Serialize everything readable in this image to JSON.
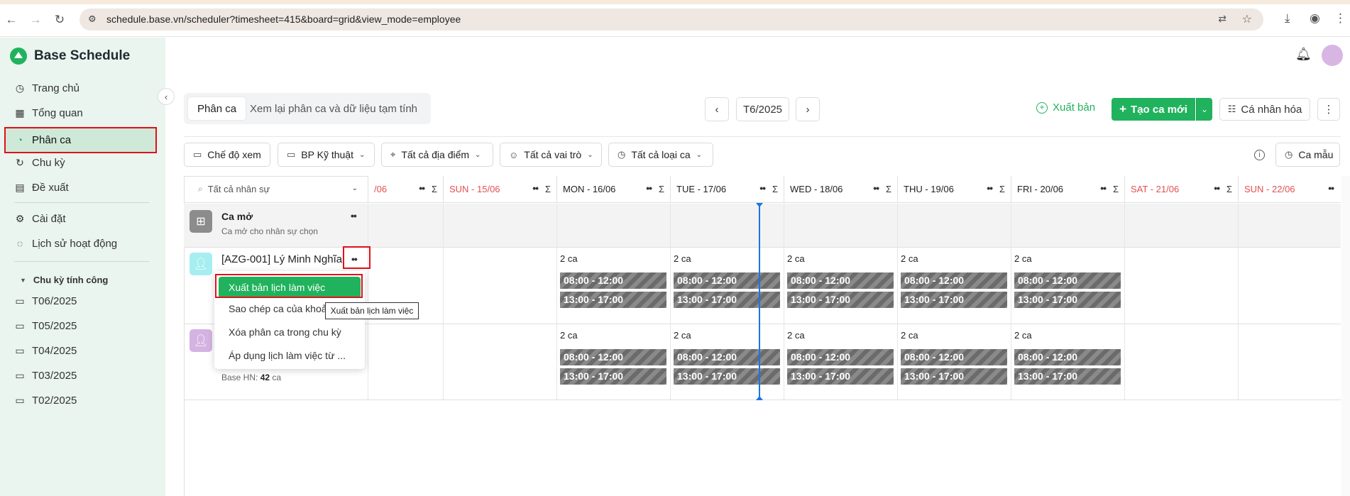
{
  "browser": {
    "url": "schedule.base.vn/scheduler?timesheet=415&board=grid&view_mode=employee"
  },
  "app": {
    "title": "Base Schedule"
  },
  "sidebar": {
    "items": [
      {
        "label": "Trang chủ",
        "icon": "clock-icon"
      },
      {
        "label": "Tổng quan",
        "icon": "grid-icon"
      },
      {
        "label": "Phân ca",
        "icon": "schedule-icon"
      },
      {
        "label": "Chu kỳ",
        "icon": "cycle-icon"
      },
      {
        "label": "Đề xuất",
        "icon": "document-icon"
      }
    ],
    "items2": [
      {
        "label": "Cài đặt",
        "icon": "gear-icon"
      },
      {
        "label": "Lịch sử hoạt động",
        "icon": "chat-icon"
      }
    ],
    "group_label": "Chu kỳ tính công",
    "periods": [
      "T06/2025",
      "T05/2025",
      "T04/2025",
      "T03/2025",
      "T02/2025"
    ]
  },
  "header": {
    "tab_active": "Phân ca",
    "tab_other": "Xem lại phân ca và dữ liệu tạm tính",
    "period": "T6/2025",
    "publish": "Xuất bản",
    "create": "Tạo ca mới",
    "personalize": "Cá nhân hóa",
    "more": "⋮"
  },
  "filters": {
    "view_mode": "Chế độ xem",
    "department": "BP Kỹ thuật",
    "location": "Tất cả địa điểm",
    "role": "Tất cả vai trò",
    "shift_type": "Tất cả loại ca",
    "template": "Ca mẫu"
  },
  "grid": {
    "search_placeholder": "Tất cả nhân sự",
    "columns": [
      {
        "label": "/06",
        "weekend": true
      },
      {
        "label": "SUN - 15/06",
        "weekend": true
      },
      {
        "label": "MON - 16/06",
        "weekend": false
      },
      {
        "label": "TUE - 17/06",
        "weekend": false
      },
      {
        "label": "WED - 18/06",
        "weekend": false
      },
      {
        "label": "THU - 19/06",
        "weekend": false
      },
      {
        "label": "FRI - 20/06",
        "weekend": false
      },
      {
        "label": "SAT - 21/06",
        "weekend": true
      },
      {
        "label": "SUN - 22/06",
        "weekend": true
      }
    ],
    "sigma": "Σ",
    "open_shift": {
      "name": "Ca mở",
      "sub": "Ca mở cho nhân sự chọn"
    },
    "employee1": {
      "name": "[AZG-001] Lý Minh Nghĩa",
      "ca_count": "2 ca",
      "shifts": [
        "08:00 - 12:00",
        "13:00 - 17:00"
      ]
    },
    "employee2": {
      "sub_prefix": "Base HN:",
      "sub_count": "42",
      "sub_suffix": "ca",
      "ca_count": "2 ca",
      "shifts": [
        "08:00 - 12:00",
        "13:00 - 17:00"
      ]
    }
  },
  "menu": {
    "items": [
      "Xuất bản lịch làm việc",
      "Sao chép ca của khoả",
      "Xóa phân ca trong chu kỳ",
      "Áp dụng lịch làm việc từ ..."
    ],
    "tooltip": "Xuất bản lịch làm việc"
  }
}
